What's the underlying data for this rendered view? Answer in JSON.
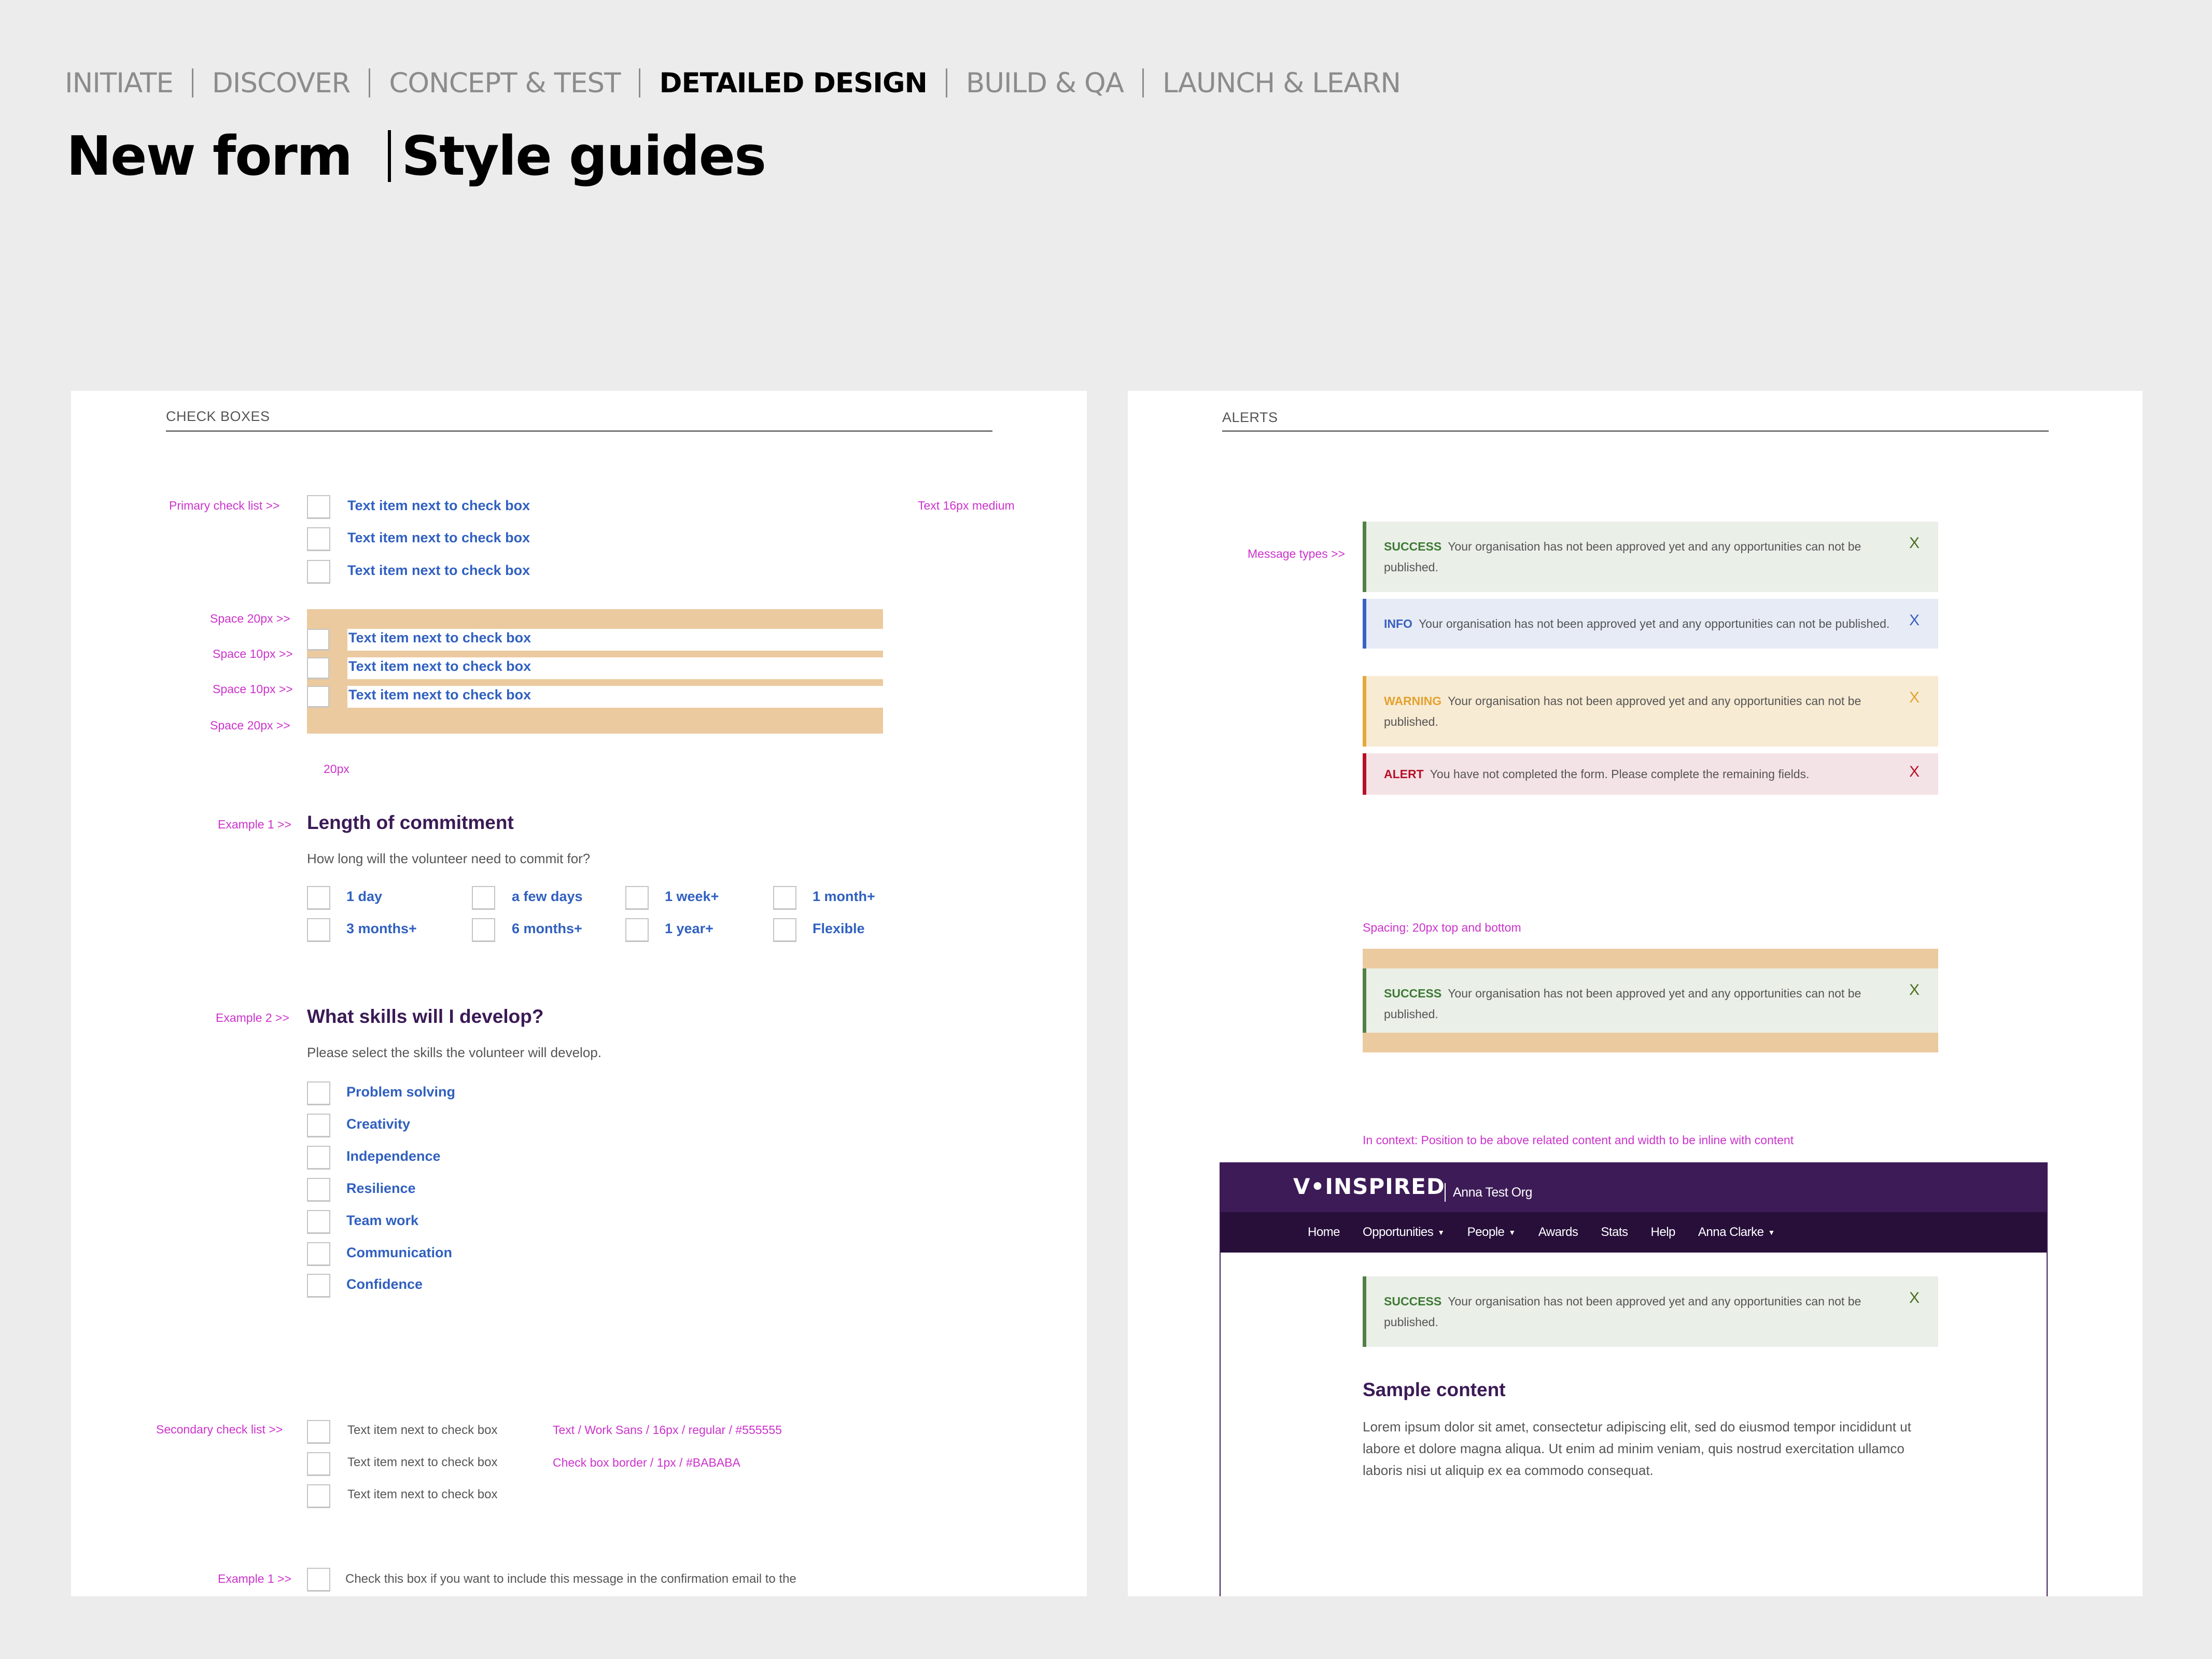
{
  "phases": [
    {
      "label": "INITIATE",
      "active": false
    },
    {
      "label": "DISCOVER",
      "active": false
    },
    {
      "label": "CONCEPT & TEST",
      "active": false
    },
    {
      "label": "DETAILED DESIGN",
      "active": true
    },
    {
      "label": "BUILD & QA",
      "active": false
    },
    {
      "label": "LAUNCH & LEARN",
      "active": false
    }
  ],
  "title": {
    "left": "New form",
    "right": "Style guides"
  },
  "checkboxes": {
    "section_label": "CHECK BOXES",
    "primary": {
      "note": "Primary check list  >>",
      "text_note": "Text 16px medium",
      "items": [
        "Text item next to check box",
        "Text item next to check box",
        "Text item next to check box"
      ]
    },
    "spacing": {
      "notes": [
        "Space 20px >>",
        "Space 10px >>",
        "Space 10px >>",
        "Space 20px >>"
      ],
      "items": [
        "Text item next to check box",
        "Text item next to check box",
        "Text item next to check box"
      ],
      "width_note": "20px"
    },
    "example1": {
      "note": "Example 1 >>",
      "title": "Length of commitment",
      "description": "How long will the volunteer need to commit for?",
      "options": [
        [
          "1 day",
          "a few days",
          "1 week+",
          "1 month+"
        ],
        [
          "3 months+",
          "6 months+",
          "1 year+",
          "Flexible"
        ]
      ]
    },
    "example2": {
      "note": "Example 2 >>",
      "title": "What skills will I develop?",
      "description": "Please select the skills the volunteer will develop.",
      "options": [
        "Problem solving",
        "Creativity",
        "Independence",
        "Resilience",
        "Team work",
        "Communication",
        "Confidence"
      ]
    },
    "secondary": {
      "note": "Secondary check list >>",
      "items": [
        "Text item next to check box",
        "Text item next to check box",
        "Text item next to check box"
      ],
      "spec_notes": [
        "Text / Work Sans / 16px / regular / #555555",
        "Check box border / 1px / #BABABA"
      ]
    },
    "example3": {
      "note": "Example 1 >>",
      "text": "Check this box if you want to include this message in the confirmation email to the"
    }
  },
  "alerts": {
    "section_label": "ALERTS",
    "types_note": "Message types >>",
    "types": [
      {
        "kind": "SUCCESS",
        "style": "success",
        "message": "Your organisation has not been approved yet and any opportunities can not be published.",
        "close": "X"
      },
      {
        "kind": "INFO",
        "style": "info",
        "message": "Your organisation has not been approved yet and any opportunities can not be published.",
        "close": "X"
      },
      {
        "kind": "WARNING",
        "style": "warning",
        "message": "Your organisation has not been approved yet and any opportunities can not be published.",
        "close": "X"
      },
      {
        "kind": "ALERT",
        "style": "danger",
        "message": "You have not completed the form. Please complete the remaining fields.",
        "close": "X"
      }
    ],
    "spacing_note": "Spacing: 20px top and bottom",
    "spacing_example": {
      "kind": "SUCCESS",
      "message": "Your organisation has not been approved yet and any opportunities can not be published.",
      "close": "X"
    },
    "context_note": "In context: Position to be above related content and width to be inline with content",
    "context": {
      "logo": "V•INSPIRED",
      "org": "Anna Test Org",
      "nav": [
        {
          "label": "Home",
          "dropdown": false
        },
        {
          "label": "Opportunities",
          "dropdown": true
        },
        {
          "label": "People",
          "dropdown": true
        },
        {
          "label": "Awards",
          "dropdown": false
        },
        {
          "label": "Stats",
          "dropdown": false
        },
        {
          "label": "Help",
          "dropdown": false
        },
        {
          "label": "Anna Clarke",
          "dropdown": true
        }
      ],
      "caret": "▼",
      "alert": {
        "kind": "SUCCESS",
        "message": "Your organisation has not been approved yet and any opportunities can not be published.",
        "close": "X"
      },
      "content_title": "Sample content",
      "content_body": "Lorem ipsum dolor sit amet, consectetur adipiscing elit, sed do eiusmod tempor incididunt ut labore et dolore magna aliqua. Ut enim ad minim veniam, quis nostrud exercitation ullamco laboris nisi ut aliquip ex ea commodo consequat."
    }
  },
  "colors": {
    "annotation": "#cc33cc",
    "link_blue": "#3060c0",
    "heading_purple": "#3b1a55",
    "spacing_band": "#ecca9f",
    "success": "#528047",
    "info": "#3a62c6",
    "warning": "#e4a83c",
    "danger": "#b8102a",
    "checkbox_border": "#BABABA",
    "brand_header": "#3d1b57",
    "brand_nav": "#270f3a"
  }
}
